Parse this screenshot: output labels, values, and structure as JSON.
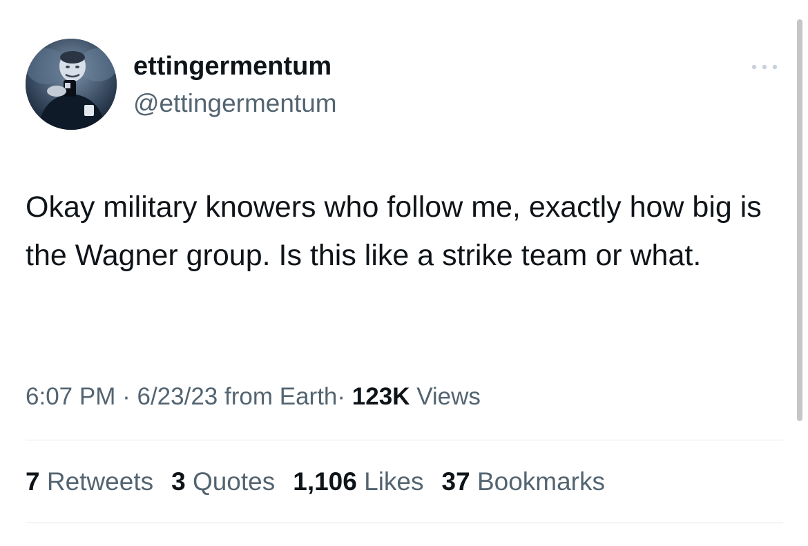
{
  "tweet": {
    "author": {
      "display_name": "ettingermentum",
      "handle": "@ettingermentum"
    },
    "more_icon": "more-horizontal-icon",
    "text": "Okay military knowers who follow me, exactly how big is the Wagner group. Is this like a strike team or what.",
    "meta": {
      "time": "6:07 PM",
      "separator": "·",
      "date": "6/23/23",
      "source": "from Earth",
      "views_count": "123K",
      "views_label": "Views"
    },
    "stats": [
      {
        "count": "7",
        "label": "Retweets"
      },
      {
        "count": "3",
        "label": "Quotes"
      },
      {
        "count": "1,106",
        "label": "Likes"
      },
      {
        "count": "37",
        "label": "Bookmarks"
      }
    ]
  },
  "colors": {
    "text_primary": "#0f1419",
    "text_secondary": "#536471",
    "divider": "#e3e7ea",
    "scrollbar": "#c6c6c6"
  }
}
